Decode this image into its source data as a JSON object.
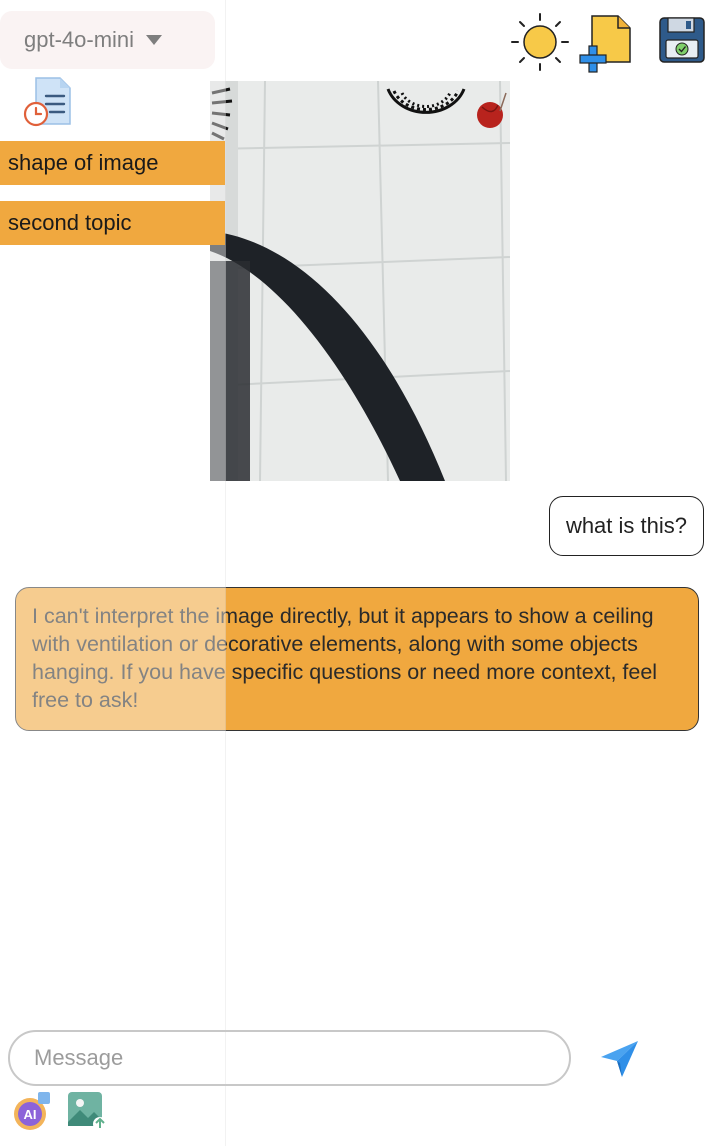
{
  "header": {
    "model_selector": {
      "value": "gpt-4o-mini",
      "icon": "caret-down-icon"
    },
    "actions": [
      {
        "name": "theme-toggle",
        "icon": "sun-icon"
      },
      {
        "name": "new-chat",
        "icon": "add-file-icon"
      },
      {
        "name": "save-chat",
        "icon": "save-icon"
      }
    ]
  },
  "sidebar": {
    "history_icon": "history-document-icon",
    "topics": [
      {
        "label": "shape of image"
      },
      {
        "label": "second topic"
      }
    ]
  },
  "conversation": {
    "image_message": {
      "description_icon": "uploaded-photo"
    },
    "user_message": "what is this?",
    "assistant_message": "I can't interpret the image directly, but it appears to show a ceiling with ventilation or decorative elements, along with some objects hanging. If you have specific questions or need more context, feel free to ask!"
  },
  "composer": {
    "placeholder": "Message",
    "send_icon": "send-icon",
    "tools": [
      {
        "name": "ai-assistant",
        "icon": "ai-icon"
      },
      {
        "name": "image-upload",
        "icon": "image-upload-icon"
      }
    ]
  },
  "colors": {
    "accent": "#f0a83f",
    "selector_bg": "#f6eaea",
    "send_blue": "#2f8fe8"
  }
}
